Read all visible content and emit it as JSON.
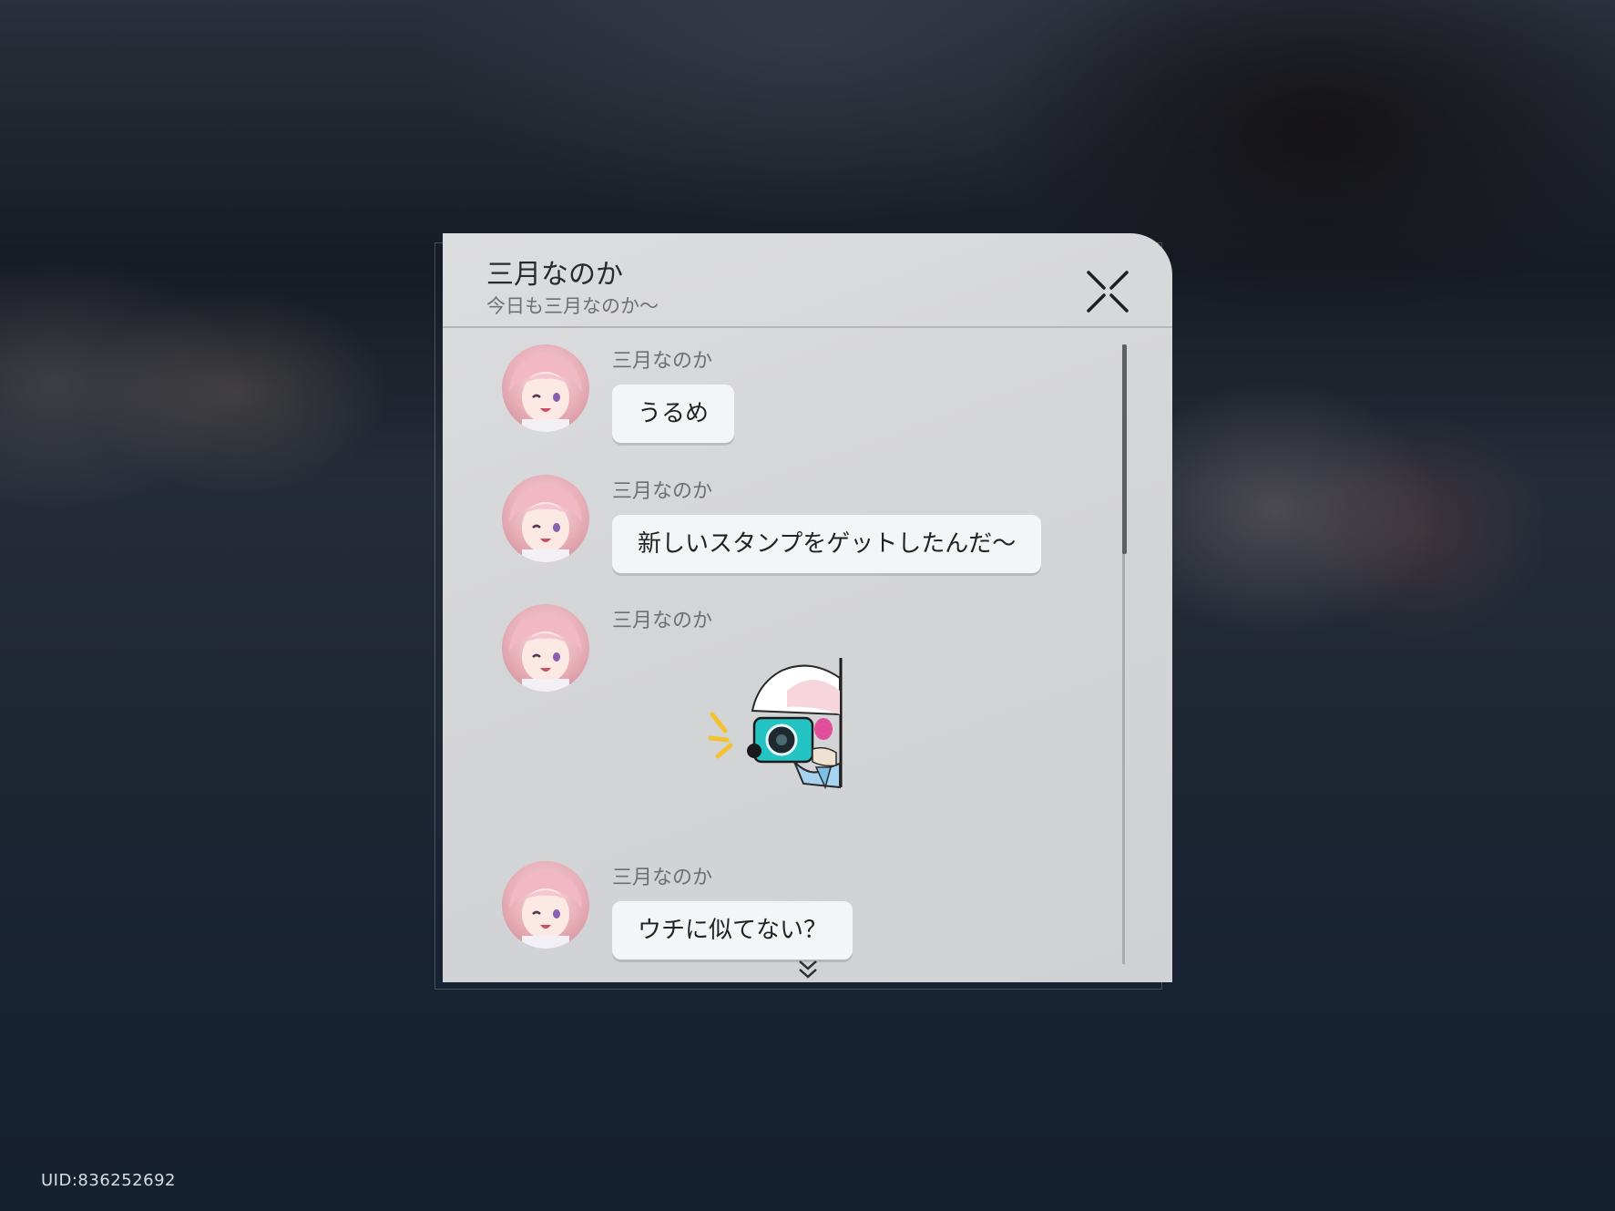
{
  "chat": {
    "title": "三月なのか",
    "subtitle": "今日も三月なのか～",
    "messages": [
      {
        "sender": "三月なのか",
        "text": "うるめ",
        "avatar_icon": "march-7th-avatar"
      },
      {
        "sender": "三月なのか",
        "text": "新しいスタンプをゲットしたんだ～",
        "avatar_icon": "march-7th-avatar"
      },
      {
        "sender": "三月なのか",
        "sticker_icon": "march-7th-camera-sticker",
        "avatar_icon": "march-7th-avatar"
      },
      {
        "sender": "三月なのか",
        "text": "ウチに似てない？",
        "avatar_icon": "march-7th-avatar"
      }
    ],
    "close_icon": "close-icon",
    "more_icon": "chevron-down-double-icon"
  },
  "footer": {
    "uid": "UID:836252692"
  },
  "colors": {
    "panel": "#d6d7d9",
    "bubble": "#f4f5f6",
    "background": "#1c2431"
  }
}
